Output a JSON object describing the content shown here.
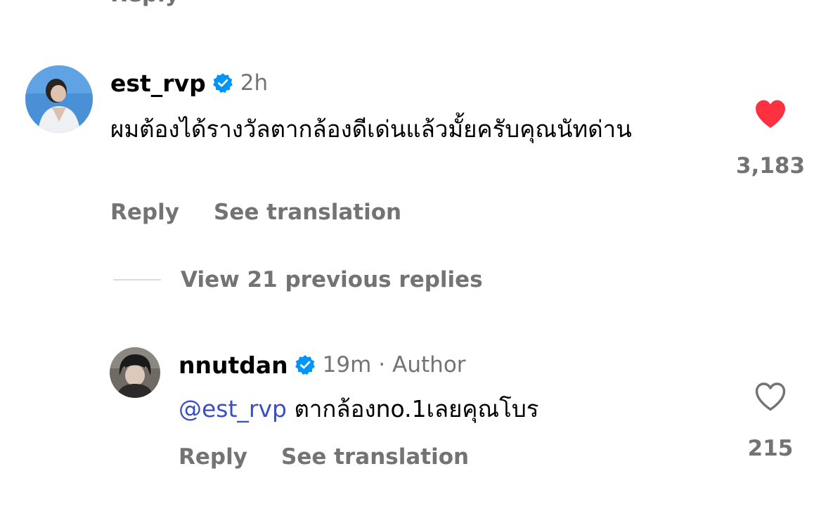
{
  "top_remnant": "Reply",
  "comment": {
    "username": "est_rvp",
    "time": "2h",
    "text": "ผมต้องได้รางวัลตากล้องดีเด่นแล้วมั้ยครับคุณนัทด่าน",
    "reply_label": "Reply",
    "translate_label": "See translation",
    "like_count": "3,183",
    "liked": true
  },
  "view_replies_label": "View 21 previous replies",
  "reply": {
    "username": "nnutdan",
    "time": "19m",
    "separator": "·",
    "author_label": "Author",
    "mention": "@est_rvp",
    "text": " ตากล้องno.1เลยคุณโบร",
    "reply_label": "Reply",
    "translate_label": "See translation",
    "like_count": "215",
    "liked": false
  },
  "colors": {
    "secondary_text": "#737373",
    "verified_badge": "#0095f6",
    "liked_heart": "#ff3040",
    "mention": "#3b4fc2"
  },
  "icons": {
    "verified": "verified-badge-icon",
    "heart_filled": "heart-filled-icon",
    "heart_outline": "heart-outline-icon"
  }
}
